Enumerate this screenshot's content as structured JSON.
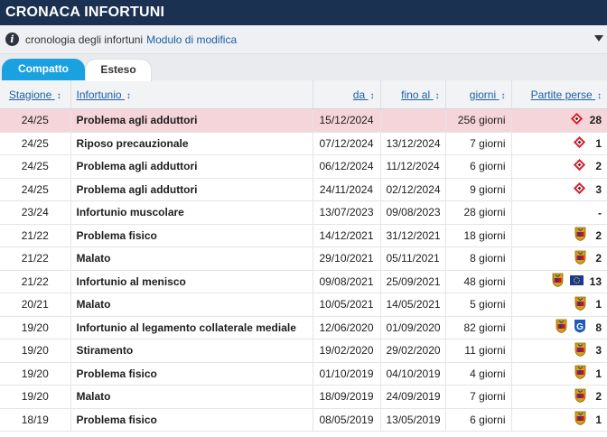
{
  "header": {
    "title": "CRONACA INFORTUNI"
  },
  "subbar": {
    "text": "cronologia degli infortuni",
    "link": "Modulo di modifica"
  },
  "tabs": [
    {
      "label": "Compatto"
    },
    {
      "label": "Esteso"
    }
  ],
  "columns": {
    "season": "Stagione",
    "injury": "Infortunio",
    "from": "da",
    "until": "fino al",
    "days": "giorni",
    "games": "Partite perse"
  },
  "sort_glyph": "↕",
  "rows": [
    {
      "season": "24/25",
      "injury": "Problema agli adduttori",
      "from": "15/12/2024",
      "until": "",
      "days": "256 giorni",
      "games": "28",
      "crests": [
        "lille"
      ],
      "highlight": true
    },
    {
      "season": "24/25",
      "injury": "Riposo precauzionale",
      "from": "07/12/2024",
      "until": "13/12/2024",
      "days": "7 giorni",
      "games": "1",
      "crests": [
        "lille"
      ],
      "highlight": false
    },
    {
      "season": "24/25",
      "injury": "Problema agli adduttori",
      "from": "06/12/2024",
      "until": "11/12/2024",
      "days": "6 giorni",
      "games": "2",
      "crests": [
        "lille"
      ],
      "highlight": false
    },
    {
      "season": "24/25",
      "injury": "Problema agli adduttori",
      "from": "24/11/2024",
      "until": "02/12/2024",
      "days": "9 giorni",
      "games": "3",
      "crests": [
        "lille"
      ],
      "highlight": false
    },
    {
      "season": "23/24",
      "injury": "Infortunio muscolare",
      "from": "13/07/2023",
      "until": "09/08/2023",
      "days": "28 giorni",
      "games": "-",
      "crests": [],
      "highlight": false
    },
    {
      "season": "21/22",
      "injury": "Problema fisico",
      "from": "14/12/2021",
      "until": "31/12/2021",
      "days": "18 giorni",
      "games": "2",
      "crests": [
        "club"
      ],
      "highlight": false
    },
    {
      "season": "21/22",
      "injury": "Malato",
      "from": "29/10/2021",
      "until": "05/11/2021",
      "days": "8 giorni",
      "games": "2",
      "crests": [
        "club"
      ],
      "highlight": false
    },
    {
      "season": "21/22",
      "injury": "Infortunio al menisco",
      "from": "09/08/2021",
      "until": "25/09/2021",
      "days": "48 giorni",
      "games": "13",
      "crests": [
        "club",
        "eu"
      ],
      "highlight": false
    },
    {
      "season": "20/21",
      "injury": "Malato",
      "from": "10/05/2021",
      "until": "14/05/2021",
      "days": "5 giorni",
      "games": "1",
      "crests": [
        "club"
      ],
      "highlight": false
    },
    {
      "season": "19/20",
      "injury": "Infortunio al legamento collaterale mediale",
      "from": "12/06/2020",
      "until": "01/09/2020",
      "days": "82 giorni",
      "games": "8",
      "crests": [
        "club",
        "genk"
      ],
      "highlight": false
    },
    {
      "season": "19/20",
      "injury": "Stiramento",
      "from": "19/02/2020",
      "until": "29/02/2020",
      "days": "11 giorni",
      "games": "3",
      "crests": [
        "club"
      ],
      "highlight": false
    },
    {
      "season": "19/20",
      "injury": "Problema fisico",
      "from": "01/10/2019",
      "until": "04/10/2019",
      "days": "4 giorni",
      "games": "1",
      "crests": [
        "club"
      ],
      "highlight": false
    },
    {
      "season": "19/20",
      "injury": "Malato",
      "from": "18/09/2019",
      "until": "24/09/2019",
      "days": "7 giorni",
      "games": "2",
      "crests": [
        "club"
      ],
      "highlight": false
    },
    {
      "season": "18/19",
      "injury": "Problema fisico",
      "from": "08/05/2019",
      "until": "13/05/2019",
      "days": "6 giorni",
      "games": "1",
      "crests": [
        "club"
      ],
      "highlight": false
    }
  ],
  "colors": {
    "header_bg": "#1a3151",
    "tab_active": "#1aa1e0",
    "link": "#1a5fa8",
    "highlight_row": "#f5d5d9"
  }
}
